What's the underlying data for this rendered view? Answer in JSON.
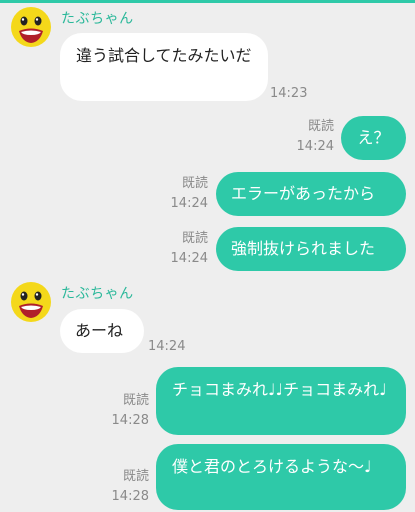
{
  "colors": {
    "accent": "#2ec9a8",
    "background": "#eeeeee",
    "incoming_bubble": "#ffffff",
    "sender_name": "#2bb89a"
  },
  "messages": [
    {
      "direction": "incoming",
      "sender": "たぶちゃん",
      "avatar_icon": "yellow-chick-avatar-icon",
      "text": "違う試合してたみたいだ",
      "time": "14:23"
    },
    {
      "direction": "outgoing",
      "read_label": "既読",
      "text": "え？",
      "time": "14:24"
    },
    {
      "direction": "outgoing",
      "read_label": "既読",
      "text": "エラーがあったから",
      "time": "14:24"
    },
    {
      "direction": "outgoing",
      "read_label": "既読",
      "text": "強制抜けられました",
      "time": "14:24"
    },
    {
      "direction": "incoming",
      "sender": "たぶちゃん",
      "avatar_icon": "yellow-chick-avatar-icon",
      "text": "あーね",
      "time": "14:24"
    },
    {
      "direction": "outgoing",
      "read_label": "既読",
      "text": "チョコまみれ♩♩チョコまみれ♩",
      "time": "14:28"
    },
    {
      "direction": "outgoing",
      "read_label": "既読",
      "text": "僕と君のとろけるような〜♩",
      "time": "14:28"
    }
  ]
}
